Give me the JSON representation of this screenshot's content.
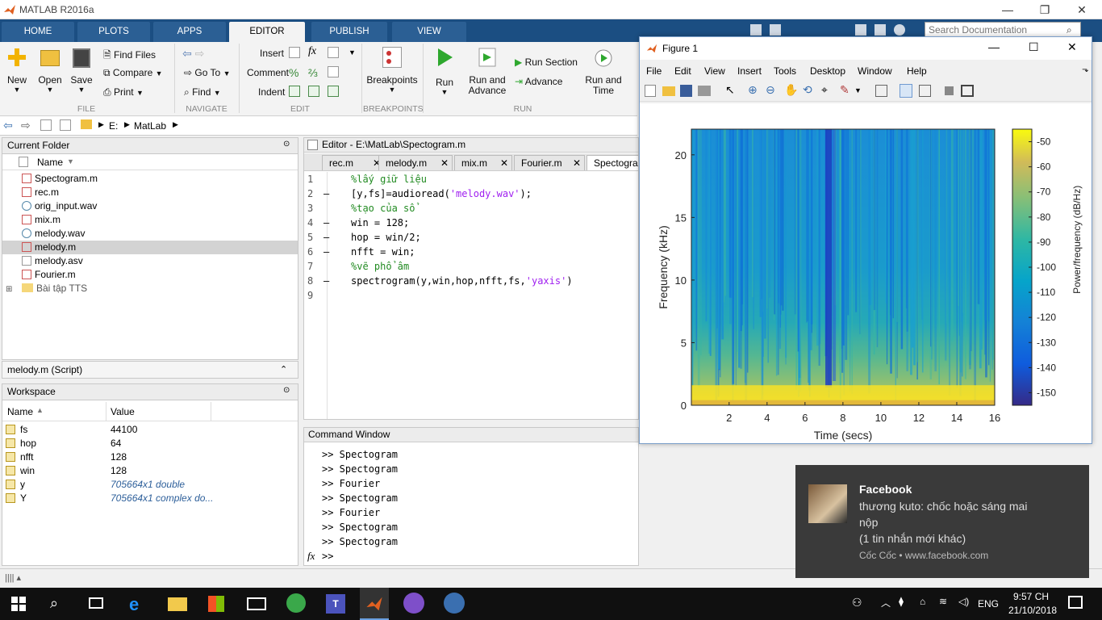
{
  "app": {
    "title": "MATLAB R2016a"
  },
  "ribbon_tabs": [
    {
      "label": "HOME"
    },
    {
      "label": "PLOTS"
    },
    {
      "label": "APPS"
    },
    {
      "label": "EDITOR"
    },
    {
      "label": "PUBLISH"
    },
    {
      "label": "VIEW"
    }
  ],
  "search": {
    "placeholder": "Search Documentation"
  },
  "ribbon": {
    "file": {
      "new": "New",
      "open": "Open",
      "save": "Save",
      "find_files": "Find Files",
      "compare": "Compare",
      "print": "Print",
      "label": "FILE"
    },
    "navigate": {
      "goto": "Go To",
      "find": "Find",
      "label": "NAVIGATE"
    },
    "edit": {
      "insert": "Insert",
      "comment": "Comment",
      "indent": "Indent",
      "fx": "fx",
      "label": "EDIT"
    },
    "breakpoints": {
      "btn": "Breakpoints",
      "label": "BREAKPOINTS"
    },
    "run": {
      "run": "Run",
      "run_advance": "Run and Advance",
      "run_section": "Run Section",
      "advance": "Advance",
      "run_time": "Run and Time",
      "label": "RUN"
    }
  },
  "address": {
    "drive": "E:",
    "folder": "MatLab"
  },
  "current_folder": {
    "title": "Current Folder",
    "col_name": "Name",
    "files": [
      {
        "name": "Spectogram.m"
      },
      {
        "name": "rec.m"
      },
      {
        "name": "orig_input.wav"
      },
      {
        "name": "mix.m"
      },
      {
        "name": "melody.wav"
      },
      {
        "name": "melody.m"
      },
      {
        "name": "melody.asv"
      },
      {
        "name": "Fourier.m"
      },
      {
        "name": "Bài tập TTS"
      }
    ],
    "detail": "melody.m  (Script)"
  },
  "workspace": {
    "title": "Workspace",
    "col_name": "Name",
    "col_value": "Value",
    "vars": [
      {
        "name": "fs",
        "value": "44100"
      },
      {
        "name": "hop",
        "value": "64"
      },
      {
        "name": "nfft",
        "value": "128"
      },
      {
        "name": "win",
        "value": "128"
      },
      {
        "name": "y",
        "value": "705664x1 double"
      },
      {
        "name": "Y",
        "value": "705664x1 complex do..."
      }
    ]
  },
  "editor": {
    "title": "Editor - E:\\MatLab\\Spectogram.m",
    "tabs": [
      {
        "label": "rec.m"
      },
      {
        "label": "melody.m"
      },
      {
        "label": "mix.m"
      },
      {
        "label": "Fourier.m"
      },
      {
        "label": "Spectogram"
      }
    ],
    "lines": [
      {
        "n": "1",
        "dash": "",
        "code": "%lấy giữ liệu"
      },
      {
        "n": "2",
        "dash": "—",
        "code": "[y,fs]=audioread('melody.wav');"
      },
      {
        "n": "3",
        "dash": "",
        "code": "%tạo của sổ"
      },
      {
        "n": "4",
        "dash": "—",
        "code": "win = 128;"
      },
      {
        "n": "5",
        "dash": "—",
        "code": "hop = win/2;"
      },
      {
        "n": "6",
        "dash": "—",
        "code": "nfft = win;"
      },
      {
        "n": "7",
        "dash": "",
        "code": "%vẽ phổ âm"
      },
      {
        "n": "8",
        "dash": "—",
        "code": "spectrogram(y,win,hop,nfft,fs,'yaxis')"
      },
      {
        "n": "9",
        "dash": "",
        "code": ""
      }
    ]
  },
  "command_window": {
    "title": "Command Window",
    "lines": [
      ">> Spectogram",
      ">> Spectogram",
      ">> Fourier",
      ">> Spectogram",
      ">> Fourier",
      ">> Spectogram",
      ">> Spectogram"
    ],
    "prompt": ">>",
    "fx": "fx"
  },
  "figure": {
    "title": "Figure 1",
    "menu": [
      {
        "label": "File"
      },
      {
        "label": "Edit"
      },
      {
        "label": "View"
      },
      {
        "label": "Insert"
      },
      {
        "label": "Tools"
      },
      {
        "label": "Desktop"
      },
      {
        "label": "Window"
      },
      {
        "label": "Help"
      }
    ]
  },
  "chart_data": {
    "type": "heatmap",
    "xlabel": "Time (secs)",
    "ylabel": "Frequency (kHz)",
    "colorbar_label": "Power/frequency (dB/Hz)",
    "xlim": [
      0.01,
      16
    ],
    "ylim": [
      0,
      22.05
    ],
    "xticks": [
      2,
      4,
      6,
      8,
      10,
      12,
      14,
      16
    ],
    "yticks": [
      0,
      5,
      10,
      15,
      20
    ],
    "clim": [
      -155,
      -45
    ],
    "cticks": [
      -50,
      -60,
      -70,
      -80,
      -90,
      -100,
      -110,
      -120,
      -130,
      -140,
      -150
    ],
    "colormap": "parula",
    "dark_column_time": 7.2
  },
  "toast": {
    "app": "Facebook",
    "line1": "thương kuto: chốc hoặc sáng mai",
    "line2": "nộp",
    "line3": "(1 tin nhắn mới khác)",
    "source": "Cốc Cốc • www.facebook.com"
  },
  "taskbar": {
    "lang": "ENG",
    "time": "9:57 CH",
    "date": "21/10/2018"
  },
  "colors": {
    "ribbon_blue": "#1b4e82",
    "comment_green": "#228b22",
    "string_purple": "#a020f0"
  }
}
